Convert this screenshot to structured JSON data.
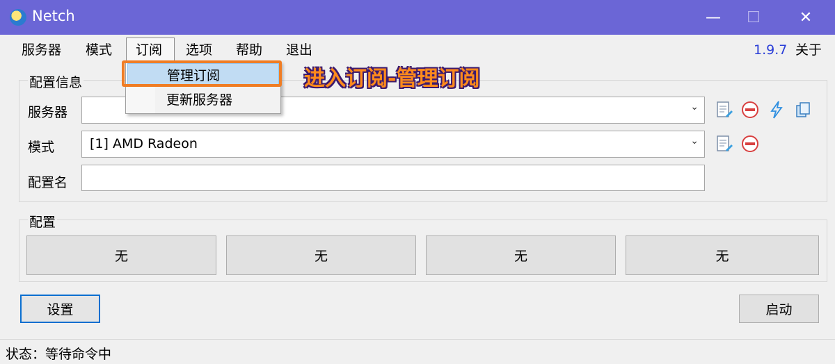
{
  "window": {
    "title": "Netch",
    "minimize": "—",
    "maximize": "☐",
    "close": "✕"
  },
  "menu": {
    "items": [
      "服务器",
      "模式",
      "订阅",
      "选项",
      "帮助",
      "退出"
    ],
    "version": "1.9.7",
    "about": "关于"
  },
  "dropdown": {
    "items": [
      "管理订阅",
      "更新服务器"
    ]
  },
  "annotation": "进入订阅-管理订阅",
  "config_info": {
    "group_title": "配置信息",
    "server_label": "服务器",
    "server_value": "",
    "mode_label": "模式",
    "mode_value": "[1] AMD Radeon",
    "profile_name_label": "配置名",
    "profile_name_value": ""
  },
  "profiles": {
    "group_title": "配置",
    "buttons": [
      "无",
      "无",
      "无",
      "无"
    ]
  },
  "actions": {
    "settings": "设置",
    "start": "启动"
  },
  "status": {
    "text": "状态：等待命令中"
  },
  "colors": {
    "titlebar": "#6b66d6",
    "version": "#2b3fd8",
    "highlight": "#f07d24",
    "annotation": "#ff8a1c"
  }
}
